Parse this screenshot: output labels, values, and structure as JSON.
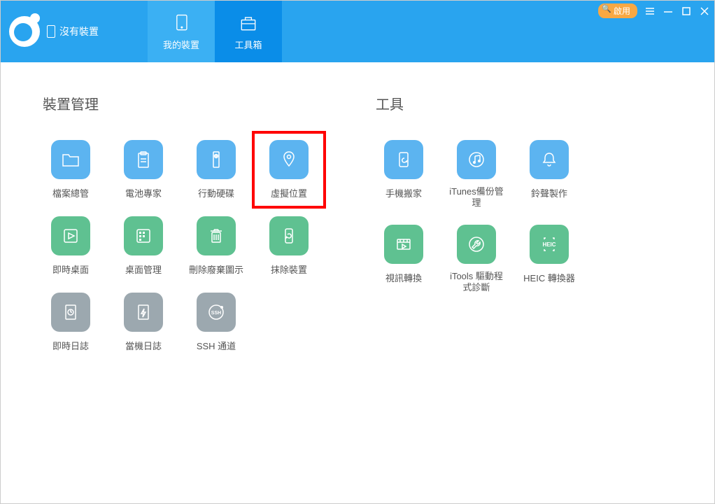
{
  "header": {
    "no_device_label": "沒有裝置",
    "tabs": {
      "my_device": "我的裝置",
      "toolbox": "工具箱"
    },
    "activate_badge": "啟用"
  },
  "sections": {
    "device_management_title": "裝置管理",
    "tools_title": "工具"
  },
  "device_tools": {
    "file_manager": "檔案總管",
    "battery_expert": "電池專家",
    "mobile_drive": "行動硬碟",
    "virtual_location": "虛擬位置",
    "realtime_desktop": "即時桌面",
    "desktop_manage": "桌面管理",
    "delete_icons": "刪除廢棄圖示",
    "erase_device": "抹除裝置",
    "realtime_log": "即時日誌",
    "crash_log": "當機日誌",
    "ssh_tunnel": "SSH 通道"
  },
  "util_tools": {
    "phone_mover": "手機搬家",
    "itunes_backup": "iTunes備份管理",
    "ringtone_maker": "鈴聲製作",
    "video_convert": "視訊轉換",
    "driver_diag": "iTools 驅動程式診斷",
    "heic_convert": "HEIC 轉換器"
  }
}
